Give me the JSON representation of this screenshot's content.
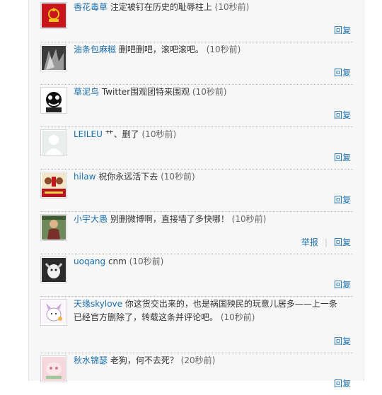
{
  "comments": [
    {
      "user": "香花毒草",
      "text": " 注定被钉在历史的耻辱柱上 ",
      "time": "(10秒前)",
      "reply": "回复"
    },
    {
      "user": "油条包麻糍",
      "text": " 删吧删吧，滚吧滚吧。 ",
      "time": "(10秒前)",
      "reply": "回复"
    },
    {
      "user": "草泥鸟",
      "text": " Twitter围观团特来围观 ",
      "time": "(10秒前)",
      "reply": "回复"
    },
    {
      "user": "LEILEU",
      "text": " ⺾、删了 ",
      "time": "(10秒前)",
      "reply": "回复"
    },
    {
      "user": "hilaw",
      "text": " 祝你永远活下去 ",
      "time": "(10秒前)",
      "reply": "回复"
    },
    {
      "user": "小宇大愚",
      "text": " 别删微博啊，直接墙了多快哪！ ",
      "time": "(10秒前)",
      "report": "举报",
      "reply": "回复"
    },
    {
      "user": "uoqang",
      "text": " cnm ",
      "time": "(10秒前)",
      "reply": "回复"
    },
    {
      "user": "天缘skylove",
      "text": " 你这货交出来的，也是祸国殃民的玩意儿居多——上一条已经官方删除了，转载这条并评论吧。 ",
      "time": "(10秒前)",
      "reply": "回复"
    },
    {
      "user": "秋水锦瑟",
      "text": " 老狗，何不去死？ ",
      "time": "(20秒前)",
      "reply": "回复"
    }
  ],
  "colors": {
    "link": "#1a6fb0",
    "text": "#333333",
    "panel_bg": "#f7f7f7"
  }
}
